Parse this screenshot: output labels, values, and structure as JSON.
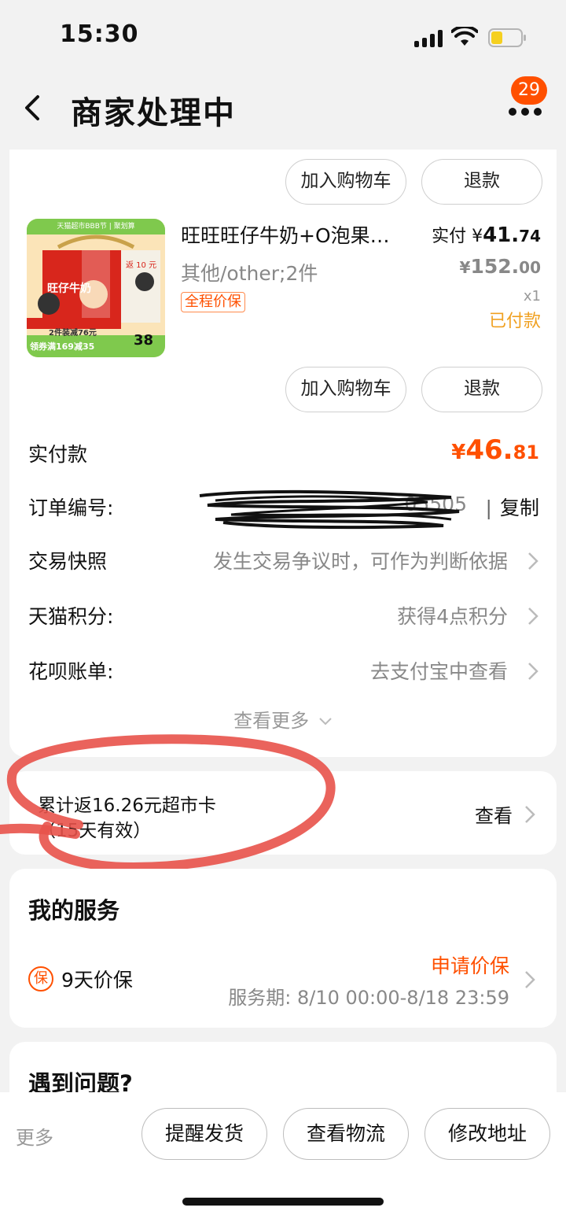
{
  "status_bar": {
    "time": "15:30"
  },
  "nav": {
    "title": "商家处理中",
    "badge": "29"
  },
  "product_top_actions": {
    "add_cart": "加入购物车",
    "refund": "退款"
  },
  "product": {
    "title": "旺旺旺仔牛奶+O泡果…",
    "sku": "其他/other;2件",
    "tag": "全程价保",
    "paid_label": "实付",
    "paid_currency": "¥",
    "paid_int": "41.",
    "paid_dec": "74",
    "orig_currency": "¥",
    "orig_int": "152.",
    "orig_dec": "00",
    "qty": "x1",
    "status": "已付款",
    "image": {
      "banner": "天猫超市BBB节 | 聚划算",
      "return_label": "返 10 元",
      "brand": "旺仔牛奶",
      "promo1": "2件装减76元",
      "promo2": "领券满169减35",
      "price": "38"
    }
  },
  "product_bottom_actions": {
    "add_cart": "加入购物车",
    "refund": "退款"
  },
  "order_info": {
    "total_label": "实付款",
    "total_currency": "¥",
    "total_int": "46.",
    "total_dec": "81",
    "order_no_label": "订单编号:",
    "order_no_tail": "05505",
    "copy": "复制",
    "snapshot_label": "交易快照",
    "snapshot_value": "发生交易争议时，可作为判断依据",
    "points_label": "天猫积分:",
    "points_value": "获得4点积分",
    "huabei_label": "花呗账单:",
    "huabei_value": "去支付宝中查看",
    "see_more": "查看更多"
  },
  "rebate": {
    "line1": "累计返16.26元超市卡",
    "line2": "（15天有效）",
    "view": "查看"
  },
  "service": {
    "title": "我的服务",
    "icon_char": "保",
    "name": "9天价保",
    "apply": "申请价保",
    "period": "服务期: 8/10 00:00-8/18 23:59"
  },
  "problem": {
    "title": "遇到问题?"
  },
  "bottom_bar": {
    "more": "更多",
    "remind": "提醒发货",
    "logistics": "查看物流",
    "address": "修改地址"
  },
  "colors": {
    "accent": "#ff5000",
    "paid_status": "#f0a020",
    "annotation": "#e8524a"
  }
}
